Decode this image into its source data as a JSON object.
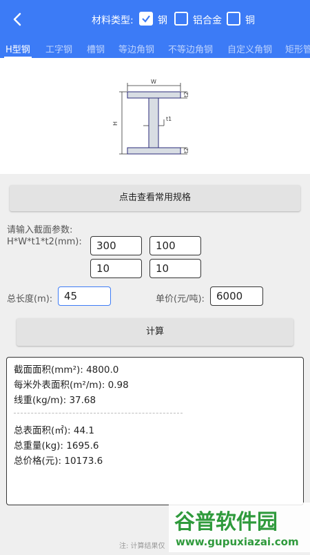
{
  "header": {
    "material_label": "材料类型:",
    "materials": [
      {
        "label": "钢",
        "checked": true
      },
      {
        "label": "铝合金",
        "checked": false
      },
      {
        "label": "铜",
        "checked": false
      }
    ],
    "tabs": [
      "H型钢",
      "工字钢",
      "槽钢",
      "等边角钢",
      "不等边角钢",
      "自定义角钢",
      "矩形管"
    ],
    "active_tab": "H型钢"
  },
  "diagram": {
    "w": "W",
    "h": "H",
    "t1": "t1",
    "t2": "t2"
  },
  "spec_button": "点击查看常用规格",
  "section": {
    "prompt": "请输入截面参数:",
    "params_label": "H*W*t1*t2(mm):",
    "h": "300",
    "w": "100",
    "t1": "10",
    "t2": "10"
  },
  "length_label": "总长度(m):",
  "length_value": "45",
  "price_label": "单价(元/吨):",
  "price_value": "6000",
  "calc_button": "计算",
  "results": {
    "area": "截面面积(mm²): 4800.0",
    "surface_per_m": "每米外表面积(m²/m): 0.98",
    "weight_per_m": "线重(kg/m): 37.68",
    "total_surface": "总表面积(㎡): 44.1",
    "total_weight": "总重量(kg): 1695.6",
    "total_price": "总价格(元): 10173.6"
  },
  "note": "注: 计算结果仅",
  "watermark": {
    "title": "谷普软件园",
    "url": "www.gupuxiazai.com"
  },
  "colors": {
    "primary": "#3c7bf6",
    "watermark_green": "#2f9a3c"
  }
}
